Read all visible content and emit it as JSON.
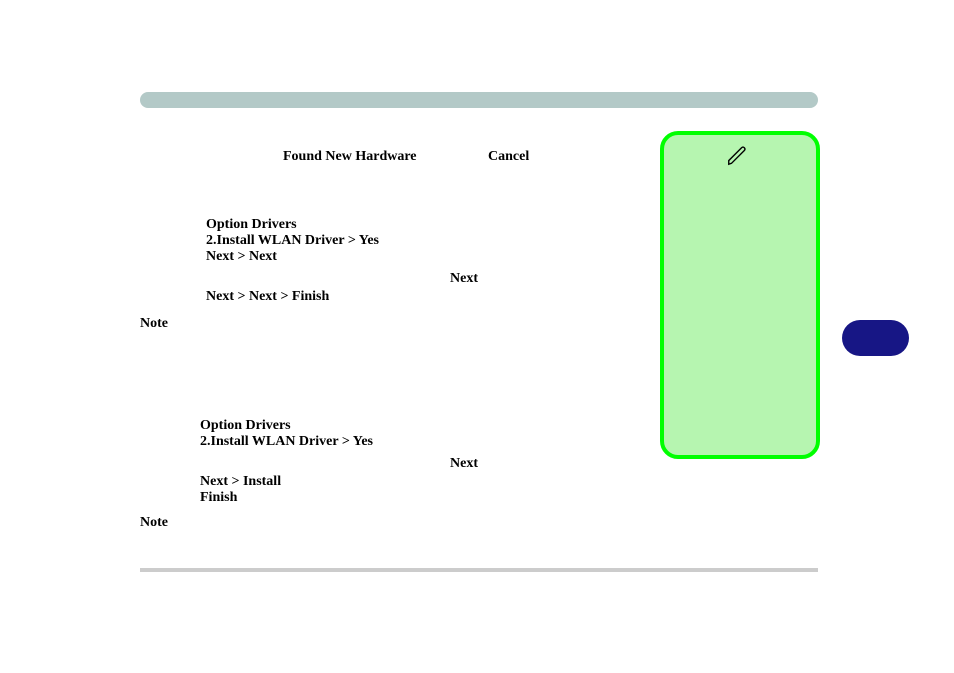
{
  "header": {
    "found_new_hardware": "Found New Hardware",
    "cancel": "Cancel"
  },
  "section1": {
    "option_drivers": "Option Drivers",
    "install_line": "2.Install WLAN Driver > Yes",
    "next_next": "Next > Next",
    "next_right": "Next",
    "next_next_finish": "Next > Next > Finish"
  },
  "note1": "Note",
  "section2": {
    "option_drivers": "Option Drivers",
    "install_line": "2.Install WLAN Driver > Yes",
    "next_right": "Next",
    "next_install": "Next > Install",
    "finish": "Finish"
  },
  "note2": "Note"
}
